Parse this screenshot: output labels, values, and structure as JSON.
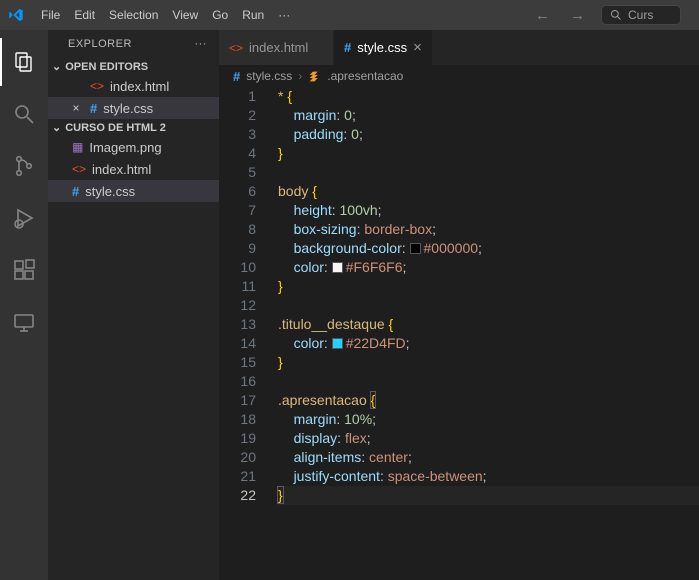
{
  "titlebar": {
    "menus": [
      "File",
      "Edit",
      "Selection",
      "View",
      "Go",
      "Run",
      "···"
    ],
    "search_placeholder": "Curs"
  },
  "activitybar": {
    "items": [
      {
        "name": "explorer-icon",
        "active": true
      },
      {
        "name": "search-icon",
        "active": false
      },
      {
        "name": "source-control-icon",
        "active": false
      },
      {
        "name": "run-debug-icon",
        "active": false
      },
      {
        "name": "extensions-icon",
        "active": false
      },
      {
        "name": "remote-icon",
        "active": false
      }
    ]
  },
  "explorer": {
    "title": "EXPLORER",
    "open_editors": {
      "label": "OPEN EDITORS",
      "items": [
        {
          "name": "index.html",
          "icon": "html",
          "active": false,
          "close": ""
        },
        {
          "name": "style.css",
          "icon": "css",
          "active": true,
          "close": "×"
        }
      ]
    },
    "folder": {
      "label": "CURSO DE HTML 2",
      "files": [
        {
          "name": "Imagem.png",
          "icon": "img",
          "active": false
        },
        {
          "name": "index.html",
          "icon": "html",
          "active": false
        },
        {
          "name": "style.css",
          "icon": "css",
          "active": true
        }
      ]
    }
  },
  "tabs": [
    {
      "name": "index.html",
      "icon": "html",
      "active": false
    },
    {
      "name": "style.css",
      "icon": "css",
      "active": true
    }
  ],
  "breadcrumb": {
    "file": "style.css",
    "symbol": ".apresentacao"
  },
  "code": {
    "current_line": 22,
    "lines": [
      {
        "n": 1,
        "t": [
          [
            "c-sel",
            "* "
          ],
          [
            "c-brace",
            "{"
          ]
        ]
      },
      {
        "n": 2,
        "t": [
          [
            "",
            "    "
          ],
          [
            "c-prop",
            "margin"
          ],
          [
            "c-punc",
            ": "
          ],
          [
            "c-num",
            "0"
          ],
          [
            "c-punc",
            ";"
          ]
        ]
      },
      {
        "n": 3,
        "t": [
          [
            "",
            "    "
          ],
          [
            "c-prop",
            "padding"
          ],
          [
            "c-punc",
            ": "
          ],
          [
            "c-num",
            "0"
          ],
          [
            "c-punc",
            ";"
          ]
        ]
      },
      {
        "n": 4,
        "t": [
          [
            "c-brace",
            "}"
          ]
        ]
      },
      {
        "n": 5,
        "t": []
      },
      {
        "n": 6,
        "t": [
          [
            "c-sel",
            "body "
          ],
          [
            "c-brace",
            "{"
          ]
        ]
      },
      {
        "n": 7,
        "t": [
          [
            "",
            "    "
          ],
          [
            "c-prop",
            "height"
          ],
          [
            "c-punc",
            ": "
          ],
          [
            "c-num",
            "100vh"
          ],
          [
            "c-punc",
            ";"
          ]
        ]
      },
      {
        "n": 8,
        "t": [
          [
            "",
            "    "
          ],
          [
            "c-prop",
            "box-sizing"
          ],
          [
            "c-punc",
            ": "
          ],
          [
            "c-val",
            "border-box"
          ],
          [
            "c-punc",
            ";"
          ]
        ]
      },
      {
        "n": 9,
        "t": [
          [
            "",
            "    "
          ],
          [
            "c-prop",
            "background-color"
          ],
          [
            "c-punc",
            ": "
          ],
          [
            "swatch",
            "#000000"
          ],
          [
            "c-val",
            "#000000"
          ],
          [
            "c-punc",
            ";"
          ]
        ]
      },
      {
        "n": 10,
        "t": [
          [
            "",
            "    "
          ],
          [
            "c-prop",
            "color"
          ],
          [
            "c-punc",
            ": "
          ],
          [
            "swatch",
            "#F6F6F6"
          ],
          [
            "c-val",
            "#F6F6F6"
          ],
          [
            "c-punc",
            ";"
          ]
        ]
      },
      {
        "n": 11,
        "t": [
          [
            "c-brace",
            "}"
          ]
        ]
      },
      {
        "n": 12,
        "t": []
      },
      {
        "n": 13,
        "t": [
          [
            "c-sel",
            ".titulo__destaque "
          ],
          [
            "c-brace",
            "{"
          ]
        ]
      },
      {
        "n": 14,
        "t": [
          [
            "",
            "    "
          ],
          [
            "c-prop",
            "color"
          ],
          [
            "c-punc",
            ": "
          ],
          [
            "swatch",
            "#22D4FD"
          ],
          [
            "c-val",
            "#22D4FD"
          ],
          [
            "c-punc",
            ";"
          ]
        ]
      },
      {
        "n": 15,
        "t": [
          [
            "c-brace",
            "}"
          ]
        ]
      },
      {
        "n": 16,
        "t": []
      },
      {
        "n": 17,
        "t": [
          [
            "c-sel",
            ".apresentacao "
          ],
          [
            "c-brace boxed-brace",
            "{"
          ]
        ]
      },
      {
        "n": 18,
        "t": [
          [
            "",
            "    "
          ],
          [
            "c-prop",
            "margin"
          ],
          [
            "c-punc",
            ": "
          ],
          [
            "c-num",
            "10%"
          ],
          [
            "c-punc",
            ";"
          ]
        ]
      },
      {
        "n": 19,
        "t": [
          [
            "",
            "    "
          ],
          [
            "c-prop",
            "display"
          ],
          [
            "c-punc",
            ": "
          ],
          [
            "c-val",
            "flex"
          ],
          [
            "c-punc",
            ";"
          ]
        ]
      },
      {
        "n": 20,
        "t": [
          [
            "",
            "    "
          ],
          [
            "c-prop",
            "align-items"
          ],
          [
            "c-punc",
            ": "
          ],
          [
            "c-val",
            "center"
          ],
          [
            "c-punc",
            ";"
          ]
        ]
      },
      {
        "n": 21,
        "t": [
          [
            "",
            "    "
          ],
          [
            "c-prop",
            "justify-content"
          ],
          [
            "c-punc",
            ": "
          ],
          [
            "c-val",
            "space-between"
          ],
          [
            "c-punc",
            ";"
          ]
        ]
      },
      {
        "n": 22,
        "t": [
          [
            "c-brace boxed-brace",
            "}"
          ]
        ]
      }
    ]
  }
}
